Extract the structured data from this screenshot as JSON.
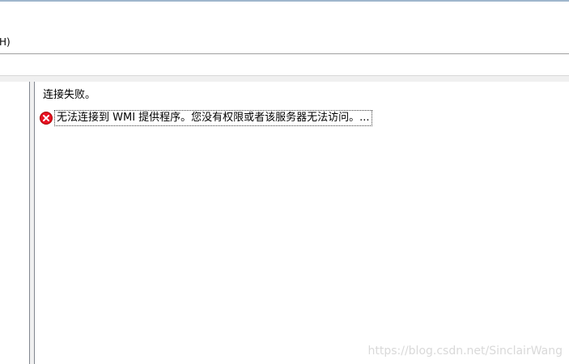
{
  "menu": {
    "help_partial": "H)"
  },
  "pane": {
    "status_text": "连接失败。",
    "error_icon": "error-icon",
    "error_message": "无法连接到 WMI 提供程序。您没有权限或者该服务器无法访问。...",
    "error_color": "#e81123"
  },
  "watermark": "https://blog.csdn.net/SinclairWang"
}
